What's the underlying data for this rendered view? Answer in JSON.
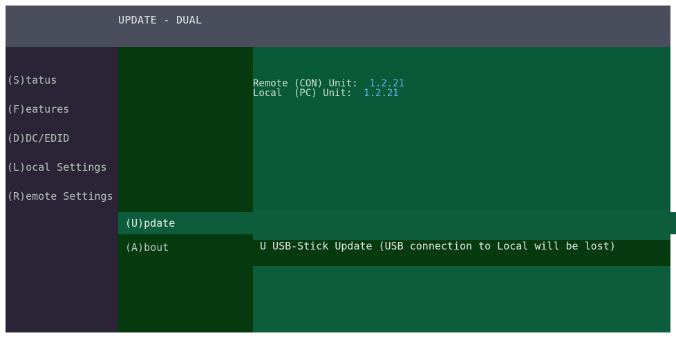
{
  "header": {
    "title": "UPDATE - DUAL"
  },
  "menu": {
    "items": [
      {
        "label": "(S)tatus"
      },
      {
        "label": "(F)eatures"
      },
      {
        "label": "(D)DC/EDID"
      },
      {
        "label": "(L)ocal  Settings"
      },
      {
        "label": "(R)emote Settings"
      },
      {
        "label": "(U)pdate"
      },
      {
        "label": "(A)bout"
      }
    ]
  },
  "info": {
    "remote_label": "Remote (CON) Unit:",
    "remote_version": "1.2.21",
    "local_label": "Local  (PC) Unit:",
    "local_version": "1.2.21"
  },
  "actions": {
    "usb_update": "U USB-Stick Update (USB connection to Local will be lost)"
  },
  "colors": {
    "titlebar": "#4a4d5c",
    "sidebar": "#2a2436",
    "menu_bg": "#053a0e",
    "content_bg": "#0d5d3d",
    "version": "#5fb8e8"
  }
}
